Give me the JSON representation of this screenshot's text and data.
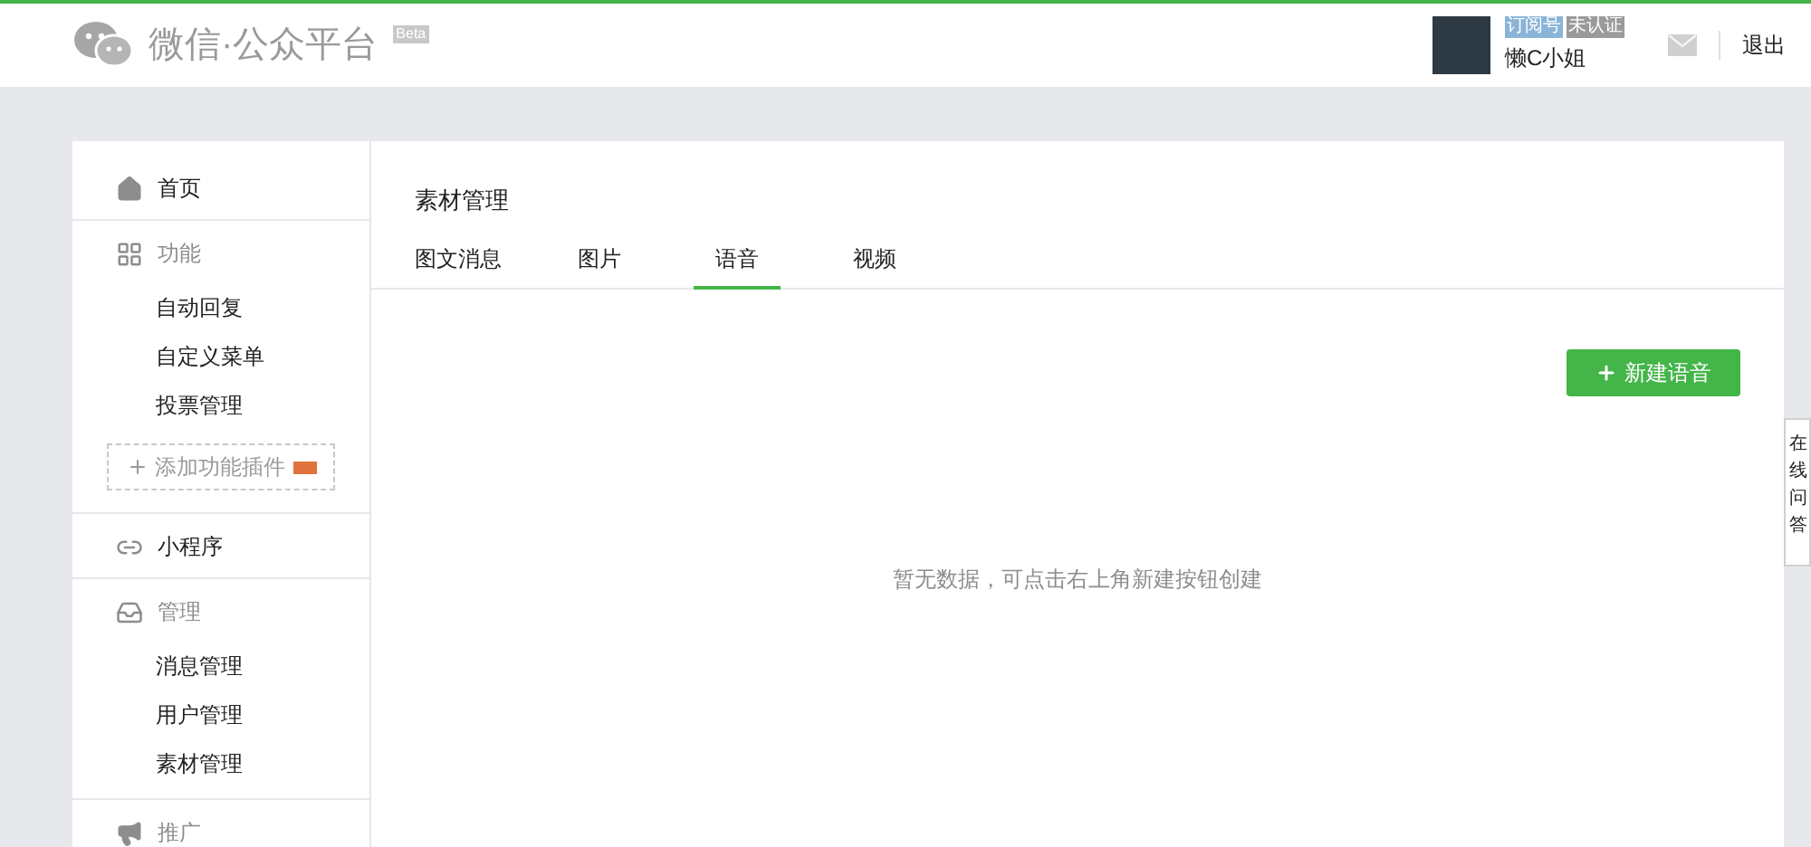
{
  "header": {
    "logo_text": "微信·公众平台",
    "beta_badge": "Beta",
    "account": {
      "type_badge": "订阅号",
      "verify_badge": "未认证",
      "name": "懒C小姐"
    },
    "logout": "退出"
  },
  "sidebar": {
    "sections": [
      {
        "kind": "link",
        "label": "首页"
      },
      {
        "kind": "group",
        "label": "功能",
        "items": [
          {
            "label": "自动回复"
          },
          {
            "label": "自定义菜单"
          },
          {
            "label": "投票管理"
          }
        ],
        "add_plugin": "添加功能插件"
      },
      {
        "kind": "link",
        "label": "小程序"
      },
      {
        "kind": "group",
        "label": "管理",
        "items": [
          {
            "label": "消息管理"
          },
          {
            "label": "用户管理"
          },
          {
            "label": "素材管理"
          }
        ]
      },
      {
        "kind": "group",
        "label": "推广"
      }
    ]
  },
  "content": {
    "title": "素材管理",
    "tabs": [
      {
        "label": "图文消息",
        "selected": false
      },
      {
        "label": "图片",
        "selected": false
      },
      {
        "label": "语音",
        "selected": true
      },
      {
        "label": "视频",
        "selected": false
      }
    ],
    "new_button": "新建语音",
    "empty_text": "暂无数据，可点击右上角新建按钮创建"
  },
  "side_help": {
    "text": "在线问答"
  }
}
